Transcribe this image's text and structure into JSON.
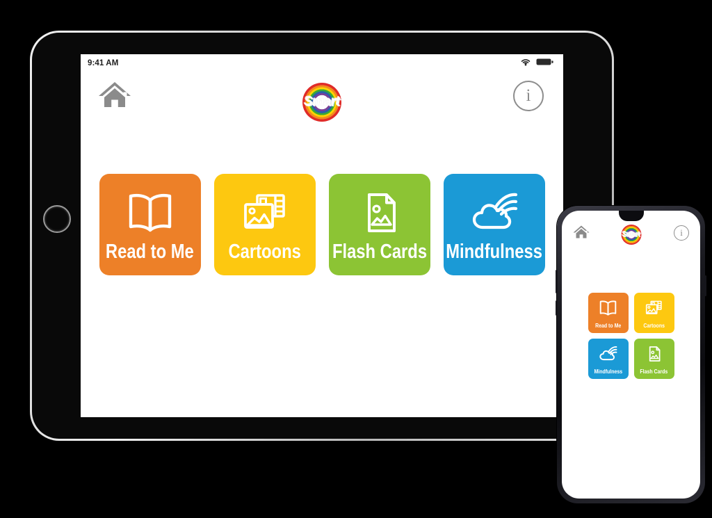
{
  "scene": {
    "background_color": "#000000",
    "devices": [
      "tablet",
      "phone"
    ]
  },
  "status_bar": {
    "time": "9:41 AM",
    "wifi_icon": "wifi-icon",
    "battery_icon": "battery-full-icon"
  },
  "header": {
    "home_icon": "home-icon",
    "logo_text": "Smart",
    "logo_icon": "rainbow-ring-logo",
    "info_icon": "info-icon",
    "info_letter": "i"
  },
  "colors": {
    "orange": "#ed8028",
    "yellow": "#fdc810",
    "green": "#8cc434",
    "blue": "#1b9ad6",
    "icon_grey": "#8d8d8d",
    "screen_bg": "#ffffff",
    "stage_bg": "#000000"
  },
  "tablet": {
    "tiles": [
      {
        "label": "Read to Me",
        "color": "#ed8028",
        "icon": "open-book-icon"
      },
      {
        "label": "Cartoons",
        "color": "#fdc810",
        "icon": "film-photo-icon"
      },
      {
        "label": "Flash Cards",
        "color": "#8cc434",
        "icon": "document-photo-icon"
      },
      {
        "label": "Mindfulness",
        "color": "#1b9ad6",
        "icon": "cloud-rainbow-icon"
      }
    ]
  },
  "phone": {
    "tiles": [
      {
        "label": "Read to Me",
        "color": "#ed8028",
        "icon": "open-book-icon"
      },
      {
        "label": "Cartoons",
        "color": "#fdc810",
        "icon": "film-photo-icon"
      },
      {
        "label": "Mindfulness",
        "color": "#1b9ad6",
        "icon": "cloud-rainbow-icon"
      },
      {
        "label": "Flash Cards",
        "color": "#8cc434",
        "icon": "document-photo-icon"
      }
    ]
  }
}
